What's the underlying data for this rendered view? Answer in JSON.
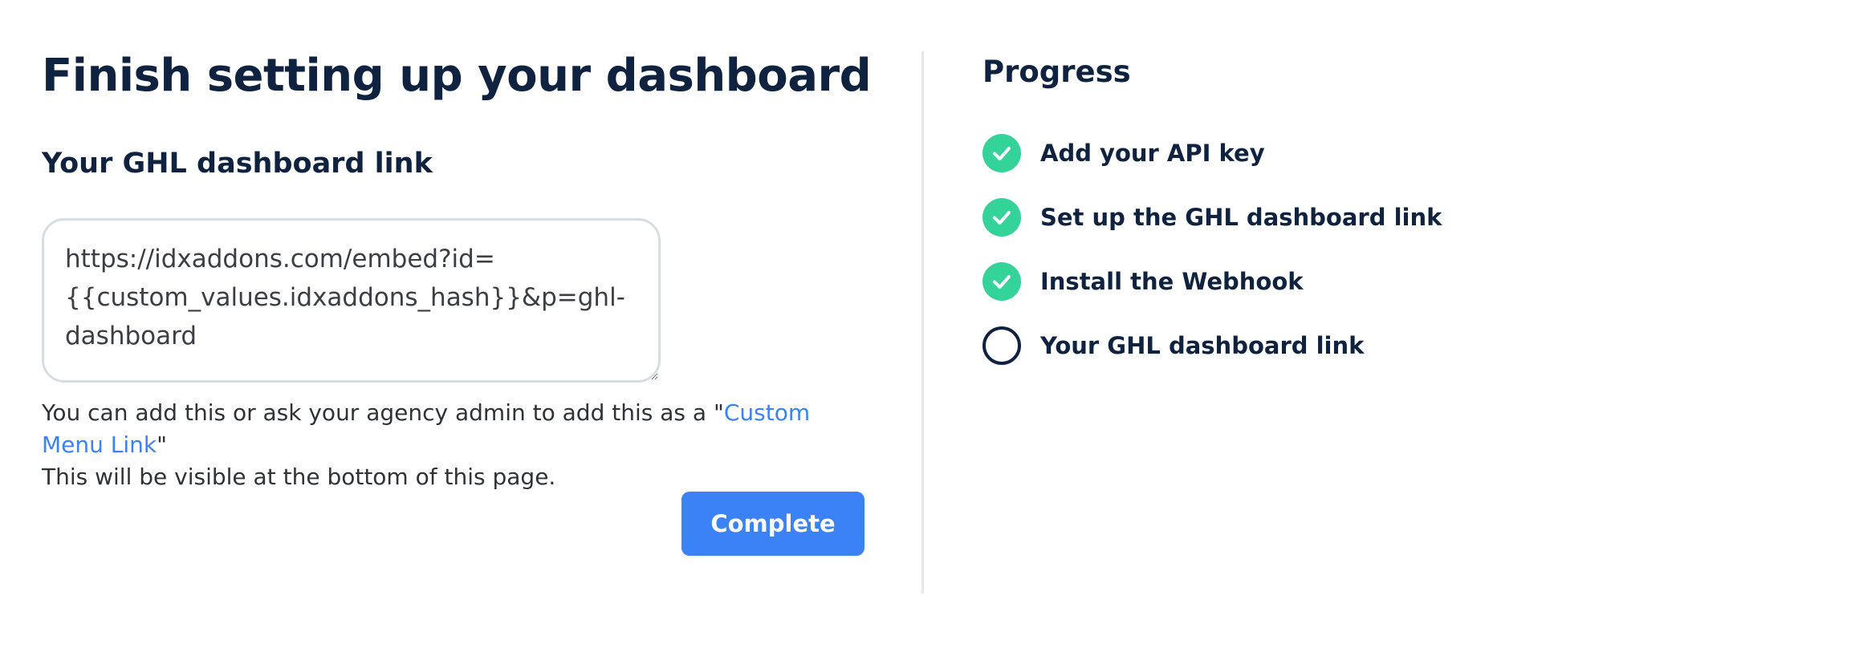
{
  "main": {
    "title": "Finish setting up your dashboard",
    "section_title": "Your GHL dashboard link",
    "dashboard_link_value": "https://idxaddons.com/embed?id={{custom_values.idxaddons_hash}}&p=ghl-dashboard",
    "help_text_prefix": "You can add this or ask your agency admin to add this as a \"",
    "help_link_label": "Custom Menu Link",
    "help_text_suffix": "\"",
    "help_text_line2": "This will be visible at the bottom of this page.",
    "complete_button_label": "Complete"
  },
  "progress": {
    "title": "Progress",
    "steps": [
      {
        "label": "Add your API key",
        "status": "complete",
        "icon": "check-circle-icon"
      },
      {
        "label": "Set up the GHL dashboard link",
        "status": "complete",
        "icon": "check-circle-icon"
      },
      {
        "label": "Install the Webhook",
        "status": "complete",
        "icon": "check-circle-icon"
      },
      {
        "label": "Your GHL dashboard link",
        "status": "incomplete",
        "icon": "empty-circle-icon"
      }
    ]
  },
  "colors": {
    "heading": "#0f2340",
    "accent_blue": "#3b82f6",
    "success_green": "#34d399",
    "border_gray": "#d7dde3"
  }
}
